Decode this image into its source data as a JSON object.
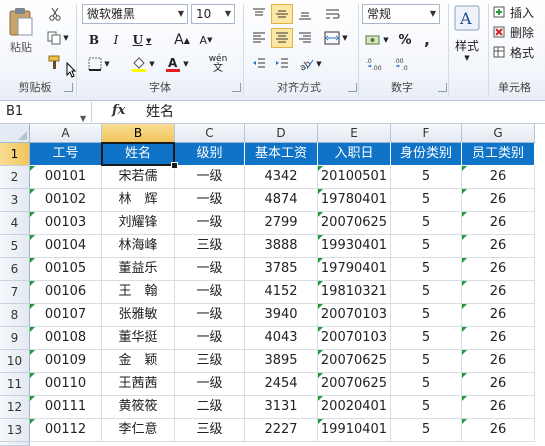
{
  "ribbon": {
    "clipboard": {
      "paste_label": "粘贴",
      "group_label": "剪贴板"
    },
    "font": {
      "name": "微软雅黑",
      "size": "10",
      "bold": "B",
      "italic": "I",
      "underline": "U",
      "grow": "A",
      "shrink": "A",
      "phonetic": "wén",
      "group_label": "字体"
    },
    "alignment": {
      "group_label": "对齐方式"
    },
    "number": {
      "format": "常规",
      "percent": "%",
      "comma": ",",
      "group_label": "数字"
    },
    "styles": {
      "label": "样式"
    },
    "cells": {
      "insert": "插入",
      "delete": "删除",
      "format": "格式",
      "group_label": "单元格"
    }
  },
  "formula_bar": {
    "name_box": "B1",
    "fx": "fx",
    "content": "姓名"
  },
  "sheet": {
    "col_headers": [
      "A",
      "B",
      "C",
      "D",
      "E",
      "F",
      "G"
    ],
    "row_numbers": [
      "1",
      "2",
      "3",
      "4",
      "5",
      "6",
      "7",
      "8",
      "9",
      "10",
      "11",
      "12",
      "13"
    ],
    "header_row": [
      "工号",
      "姓名",
      "级别",
      "基本工资",
      "入职日",
      "身份类别",
      "员工类别"
    ],
    "rows": [
      [
        "00101",
        "宋若儒",
        "一级",
        "4342",
        "20100501",
        "5",
        "26"
      ],
      [
        "00102",
        "林　辉",
        "一级",
        "4874",
        "19780401",
        "5",
        "26"
      ],
      [
        "00103",
        "刘耀锋",
        "一级",
        "2799",
        "20070625",
        "5",
        "26"
      ],
      [
        "00104",
        "林海峰",
        "三级",
        "3888",
        "19930401",
        "5",
        "26"
      ],
      [
        "00105",
        "董益乐",
        "一级",
        "3785",
        "19790401",
        "5",
        "26"
      ],
      [
        "00106",
        "王　翰",
        "一级",
        "4152",
        "19810321",
        "5",
        "26"
      ],
      [
        "00107",
        "张雅敏",
        "一级",
        "3940",
        "20070103",
        "5",
        "26"
      ],
      [
        "00108",
        "董华挺",
        "一级",
        "4043",
        "20070103",
        "5",
        "26"
      ],
      [
        "00109",
        "金　颖",
        "三级",
        "3895",
        "20070625",
        "5",
        "26"
      ],
      [
        "00110",
        "王茜茜",
        "一级",
        "2454",
        "20070625",
        "5",
        "26"
      ],
      [
        "00111",
        "黄筱筱",
        "二级",
        "3131",
        "20020401",
        "5",
        "26"
      ],
      [
        "00112",
        "李仁意",
        "三级",
        "2227",
        "19910401",
        "5",
        "26"
      ]
    ]
  },
  "colors": {
    "header_fill": "#0f74c7",
    "selection": "#f2c55c",
    "error_indicator": "#1e9a3a"
  }
}
